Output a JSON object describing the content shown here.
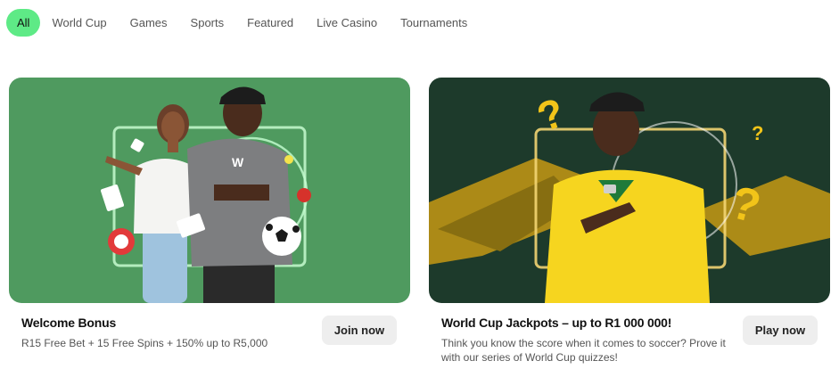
{
  "tabs": [
    {
      "label": "All",
      "active": true
    },
    {
      "label": "World Cup",
      "active": false
    },
    {
      "label": "Games",
      "active": false
    },
    {
      "label": "Sports",
      "active": false
    },
    {
      "label": "Featured",
      "active": false
    },
    {
      "label": "Live Casino",
      "active": false
    },
    {
      "label": "Tournaments",
      "active": false
    }
  ],
  "colors": {
    "accent": "#5eea86",
    "card1_background": "#4f9a5f",
    "card2_background": "#1d3a2b",
    "gold": "#c8a21a",
    "button_bg": "#eeeeee"
  },
  "promos": [
    {
      "title": "Welcome Bonus",
      "description": "R15 Free Bet + 15 Free Spins + 150% up to R5,000",
      "button_label": "Join now",
      "art": [
        "two-presenters",
        "neon-frame",
        "playing-cards",
        "casino-chip",
        "soccer-ball"
      ]
    },
    {
      "title": "World Cup Jackpots – up to R1 000 000!",
      "description": "Think you know the score when it comes to soccer? Prove it with our series of World Cup quizzes!",
      "button_label": "Play now",
      "art": [
        "man-in-yellow-jersey",
        "neon-frame",
        "question-marks",
        "gold-brush-strokes"
      ]
    }
  ]
}
